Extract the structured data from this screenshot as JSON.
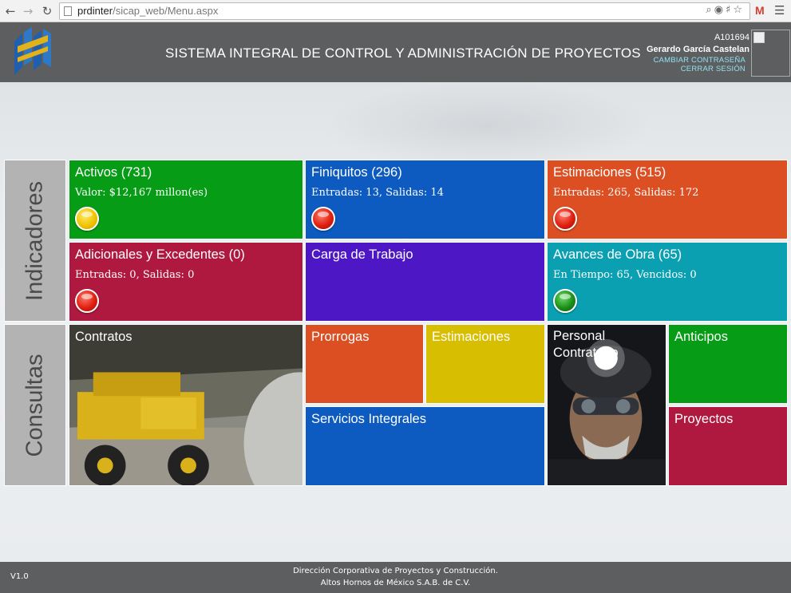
{
  "browser": {
    "url_host": "prdinter",
    "url_path": "/sicap_web/Menu.aspx",
    "gmail_label": "M",
    "icons": [
      "back-icon",
      "forward-icon",
      "reload-icon",
      "page-icon",
      "zoom-icon",
      "bulb-icon",
      "key-icon",
      "star-icon",
      "gmail-icon",
      "menu-icon"
    ]
  },
  "header": {
    "title": "SISTEMA INTEGRAL DE CONTROL Y ADMINISTRACIÓN DE PROYECTOS",
    "user_id": "A101694",
    "user_name": "Gerardo García Castelan",
    "change_password": "CAMBIAR CONTRASEÑA",
    "logout": "CERRAR SESIÓN"
  },
  "sections": {
    "indicadores": "Indicadores",
    "consultas": "Consultas"
  },
  "indicadores": {
    "activos": {
      "title": "Activos (731)",
      "subtitle": "Valor: $12,167 millon(es)",
      "light": "yellow",
      "color": "#069c15"
    },
    "finiquitos": {
      "title": "Finiquitos (296)",
      "subtitle": "Entradas: 13, Salidas: 14",
      "light": "red",
      "color": "#0d5bc0"
    },
    "estimaciones": {
      "title": "Estimaciones (515)",
      "subtitle": " Entradas: 265, Salidas: 172",
      "light": "red",
      "color": "#db4f23"
    },
    "adicionales": {
      "title": "Adicionales y Excedentes (0)",
      "subtitle": "Entradas: 0, Salidas: 0",
      "light": "red",
      "color": "#b0193f"
    },
    "carga": {
      "title": "Carga de Trabajo",
      "color": "#4d17c5"
    },
    "avances": {
      "title": "Avances de Obra (65)",
      "subtitle": "En Tiempo: 65, Vencidos: 0",
      "light": "green",
      "color": "#0aa0b1"
    }
  },
  "consultas": {
    "contratos": "Contratos",
    "prorrogas": "Prorrogas",
    "estimaciones": "Estimaciones",
    "servicios": "Servicios Integrales",
    "personal": "Personal Contratado",
    "anticipos": "Anticipos",
    "proyectos": "Proyectos"
  },
  "footer": {
    "version": "V1.0",
    "line1": "Dirección Corporativa de Proyectos y Construcción.",
    "line2": "Altos Hornos de México S.A.B. de C.V."
  }
}
